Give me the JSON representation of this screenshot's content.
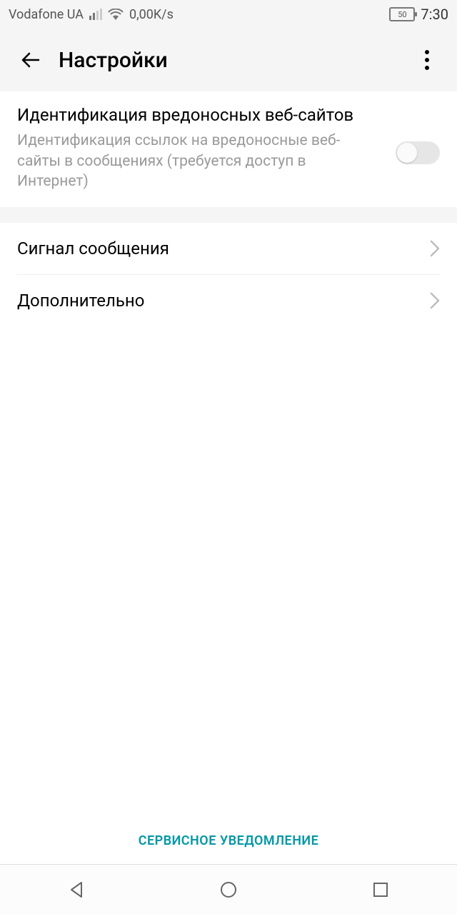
{
  "status": {
    "carrier": "Vodafone UA",
    "speed": "0,00K/s",
    "battery_pct": "50",
    "time": "7:30"
  },
  "appbar": {
    "title": "Настройки"
  },
  "malicious": {
    "title": "Идентификация вредоносных веб-сайтов",
    "desc": "Идентификация ссылок на вредоносные веб-сайты в сообщениях (требуется доступ в Интернет)"
  },
  "items": {
    "signal": "Сигнал сообщения",
    "more": "Дополнительно"
  },
  "footer": {
    "service_notice": "СЕРВИСНОЕ УВЕДОМЛЕНИЕ"
  }
}
